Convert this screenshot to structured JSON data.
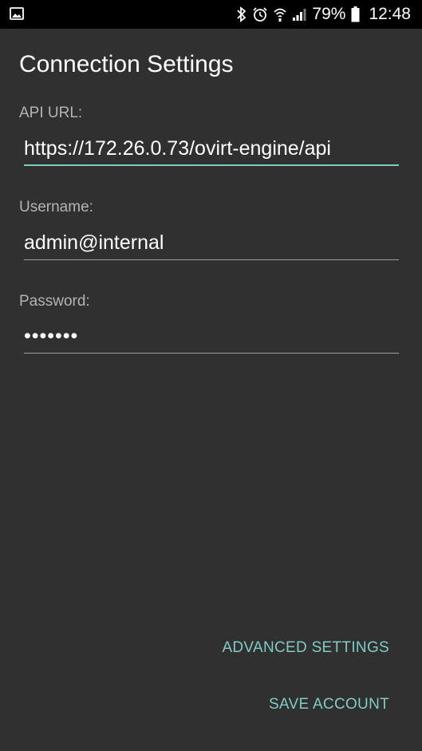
{
  "status_bar": {
    "battery_percent": "79%",
    "time": "12:48",
    "icons": [
      "image-notification-icon",
      "bluetooth-icon",
      "alarm-icon",
      "wifi-icon",
      "signal-icon",
      "battery-icon"
    ]
  },
  "page": {
    "title": "Connection Settings"
  },
  "form": {
    "api_url": {
      "label": "API URL:",
      "value": "https://172.26.0.73/ovirt-engine/api"
    },
    "username": {
      "label": "Username:",
      "value": "admin@internal"
    },
    "password": {
      "label": "Password:",
      "value": "•••••••"
    }
  },
  "actions": {
    "advanced_settings_label": "ADVANCED SETTINGS",
    "save_account_label": "SAVE ACCOUNT"
  },
  "colors": {
    "background": "#303030",
    "status_bar": "#000000",
    "accent": "#80cbc4",
    "label": "#b4b4b4",
    "underline": "#9e9e9e"
  }
}
